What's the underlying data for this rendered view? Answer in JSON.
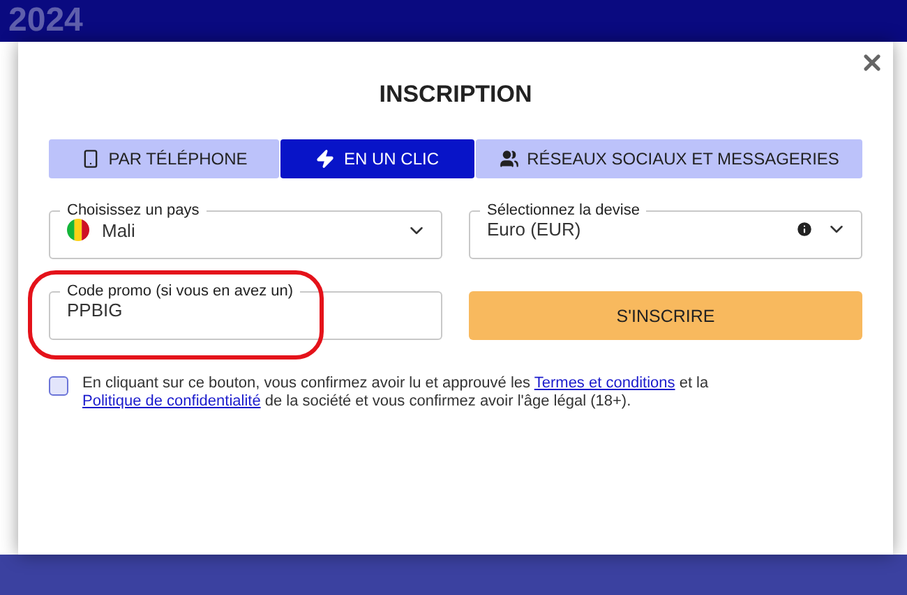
{
  "background": {
    "heading": "2024"
  },
  "dialog": {
    "title": "INSCRIPTION",
    "tabs": [
      {
        "kind": "phone",
        "label": "PAR TÉLÉPHONE",
        "selected": false
      },
      {
        "kind": "bolt",
        "label": "EN UN CLIC",
        "selected": true
      },
      {
        "kind": "users",
        "label": "RÉSEAUX SOCIAUX ET MESSAGERIES",
        "selected": false
      }
    ],
    "fields": [
      {
        "kind": "country",
        "label": "Choisissez un pays",
        "value": "Mali",
        "highlighted": false
      },
      {
        "kind": "currency",
        "label": "Sélectionnez la devise",
        "value": "Euro (EUR)",
        "highlighted": false
      },
      {
        "kind": "promo",
        "label": "Code promo (si vous en avez un)",
        "value": "PPBIG",
        "highlighted": true
      }
    ],
    "submit": "S'INSCRIRE",
    "consent": {
      "checked": false,
      "parts": [
        {
          "text": "En cliquant sur ce bouton, vous confirmez avoir lu et approuvé les ",
          "link": false
        },
        {
          "text": "Termes et conditions",
          "link": true
        },
        {
          "text": " et la ",
          "link": false
        },
        {
          "text": "Politique de confidentialité",
          "link": true
        },
        {
          "text": " de la société et vous confirmez avoir l'âge légal (18+).",
          "link": false
        }
      ]
    }
  }
}
